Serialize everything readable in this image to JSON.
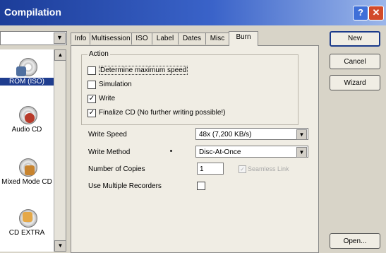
{
  "window": {
    "title": "Compilation",
    "help_symbol": "?",
    "close_symbol": "✕"
  },
  "combo_arrow": "▼",
  "left_pane": {
    "items": [
      {
        "label": "ROM (ISO)",
        "icon": "cd-rom-iso-icon"
      },
      {
        "label": "Audio CD",
        "icon": "audio-cd-icon"
      },
      {
        "label": "Mixed Mode CD",
        "icon": "mixed-mode-cd-icon"
      },
      {
        "label": "CD EXTRA",
        "icon": "cd-extra-icon"
      }
    ],
    "scroll_up": "▲",
    "scroll_down": "▼"
  },
  "tabs": [
    "Info",
    "Multisession",
    "ISO",
    "Label",
    "Dates",
    "Misc",
    "Burn"
  ],
  "burn": {
    "action_title": "Action",
    "determine_speed": {
      "label": "Determine maximum speed",
      "mark": ""
    },
    "simulation": {
      "label": "Simulation",
      "mark": ""
    },
    "write": {
      "label": "Write",
      "mark": "✓"
    },
    "finalize": {
      "label": "Finalize CD (No further writing possible!)",
      "mark": "✓"
    },
    "write_speed_label": "Write Speed",
    "write_speed_value": "48x (7,200 KB/s)",
    "write_method_label": "Write Method",
    "write_method_value": "Disc-At-Once",
    "copies_label": "Number of Copies",
    "copies_value": "1",
    "seamless_label": "Seamless Link",
    "seamless_mark": "✓",
    "multiple_label": "Use Multiple Recorders",
    "multiple_mark": ""
  },
  "buttons": {
    "new": "New",
    "cancel": "Cancel",
    "wizard": "Wizard",
    "open": "Open..."
  }
}
